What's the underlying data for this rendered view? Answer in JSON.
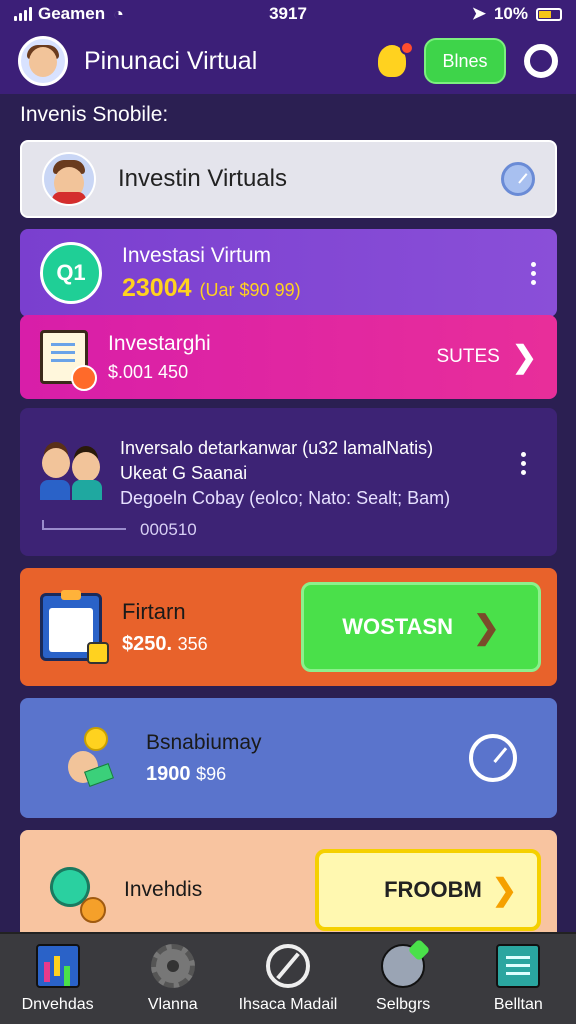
{
  "status_bar": {
    "carrier": "Geamen",
    "time": "3917",
    "battery": "10%"
  },
  "header": {
    "title": "Pinunaci Virtual",
    "bonus_label": "Blnes"
  },
  "section_label": "Invenis Snobile:",
  "search_card": {
    "title": "Investin Virtuals"
  },
  "rows": [
    {
      "badge": "Q1",
      "title": "Investasi Virtum",
      "amount": "23004",
      "amount_sub": "(Uar $90 99)"
    },
    {
      "title": "Investarghi",
      "amount": "$.001 450",
      "action_label": "SUTES"
    },
    {
      "line1": "Inversalo detarkanwar (u32 lamalNatis)",
      "line2": "Ukeat G Saanai",
      "line3": "Degoeln Cobay (eolco; Nato: Sealt; Bam)",
      "progress_value": "000510"
    },
    {
      "title": "Firtarn",
      "amount": "$250.",
      "amount_sub": "356",
      "action_label": "WOSTASN"
    },
    {
      "title": "Bsnabiumay",
      "amount": "1900",
      "amount_sub": "$96"
    },
    {
      "title": "Invehdis",
      "action_label": "FROOBM"
    }
  ],
  "bottom_nav": [
    {
      "label": "Dnvehdas",
      "icon": "chart-icon"
    },
    {
      "label": "Vlanna",
      "icon": "gear-icon"
    },
    {
      "label": "Ihsaca Madail",
      "icon": "compass-icon"
    },
    {
      "label": "Selbgrs",
      "icon": "chat-icon"
    },
    {
      "label": "Belltan",
      "icon": "ledger-icon"
    }
  ],
  "colors": {
    "header_bg": "#3c1f78",
    "accent_green": "#3ed44a",
    "accent_yellow": "#ffd21f",
    "pink": "#d81ea9",
    "orange": "#e8622b",
    "blue": "#5a74cc",
    "peach": "#f8c4a0"
  }
}
